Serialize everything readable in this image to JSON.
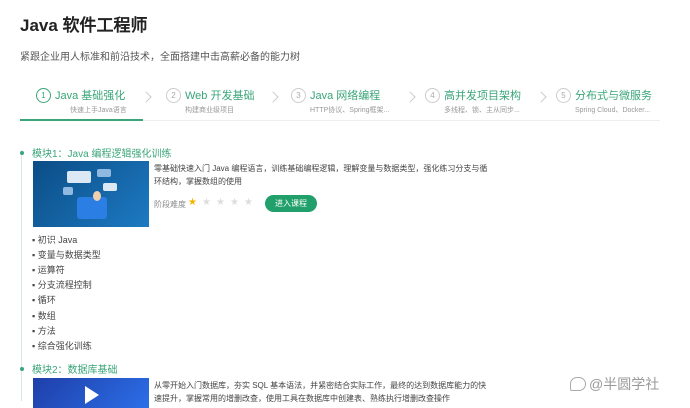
{
  "header": {
    "title": "Java 软件工程师",
    "subtitle": "紧跟企业用人标准和前沿技术，全面搭建中击高薪必备的能力树"
  },
  "steps": [
    {
      "num": "1",
      "label": "Java 基础强化",
      "desc": "快速上手Java语言"
    },
    {
      "num": "2",
      "label": "Web 开发基础",
      "desc": "构建商业级项目"
    },
    {
      "num": "3",
      "label": "Java 网络编程",
      "desc": "HTTP协议、Spring框架..."
    },
    {
      "num": "4",
      "label": "高并发项目架构",
      "desc": "多线程、锁、主从同步..."
    },
    {
      "num": "5",
      "label": "分布式与微服务",
      "desc": "Spring Cloud、Docker..."
    }
  ],
  "modules": [
    {
      "title": "模块1：Java 编程逻辑强化训练",
      "description": "零基础快速入门 Java 编程语言，训练基础编程逻辑，理解变量与数据类型，强化练习分支与循环结构，掌握数组的使用",
      "difficulty_label": "阶段难度",
      "difficulty": 1,
      "difficulty_max": 5,
      "button_label": "进入课程",
      "items": [
        "初识 Java",
        "变量与数据类型",
        "运算符",
        "分支流程控制",
        "循环",
        "数组",
        "方法",
        "综合强化训练"
      ]
    },
    {
      "title": "模块2：数据库基础",
      "description": "从零开始入门数据库，夯实 SQL 基本语法，并紧密结合实际工作，最终的达到数据库能力的快速提升，掌握常用的增删改查，使用工具在数据库中创建表、熟练执行增删改查操作"
    }
  ],
  "watermark": "@半圆学社",
  "colors": {
    "accent": "#3aa57a",
    "button": "#22a06b",
    "star": "#f5b400"
  }
}
